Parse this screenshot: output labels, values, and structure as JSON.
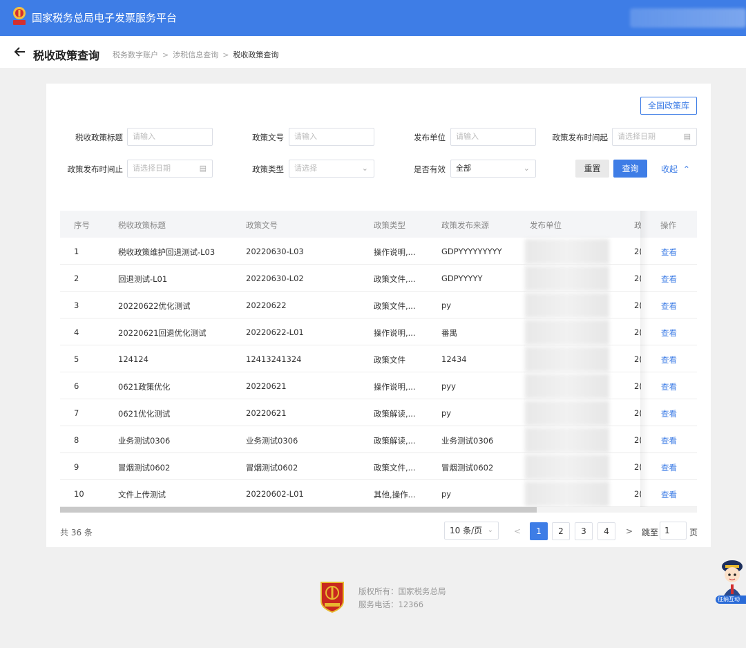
{
  "header": {
    "title": "国家税务总局电子发票服务平台"
  },
  "subheader": {
    "title": "税收政策查询",
    "breadcrumb": [
      "税务数字账户",
      "涉税信息查询",
      "税收政策查询"
    ],
    "sep": ">"
  },
  "toolbar": {
    "library_button": "全国政策库"
  },
  "filters": {
    "title_label": "税收政策标题",
    "title_placeholder": "请输入",
    "docno_label": "政策文号",
    "docno_placeholder": "请输入",
    "publisher_label": "发布单位",
    "publisher_placeholder": "请输入",
    "start_label": "政策发布时间起",
    "start_placeholder": "请选择日期",
    "end_label": "政策发布时间止",
    "end_placeholder": "请选择日期",
    "type_label": "政策类型",
    "type_placeholder": "请选择",
    "valid_label": "是否有效",
    "valid_value": "全部",
    "reset": "重置",
    "query": "查询",
    "collapse": "收起"
  },
  "table": {
    "headers": [
      "序号",
      "税收政策标题",
      "政策文号",
      "政策类型",
      "政策发布来源",
      "发布单位",
      "政",
      "操作"
    ],
    "rows": [
      {
        "no": "1",
        "title": "税收政策维护回退测试-L03",
        "docno": "20220630-L03",
        "type": "操作说明,...",
        "source": "GDPYYYYYYYYY",
        "date": "2(",
        "action": "查看"
      },
      {
        "no": "2",
        "title": "回退测试-L01",
        "docno": "20220630-L02",
        "type": "政策文件,...",
        "source": "GDPYYYYY",
        "date": "2(",
        "action": "查看"
      },
      {
        "no": "3",
        "title": "20220622优化测试",
        "docno": "20220622",
        "type": "政策文件,...",
        "source": "py",
        "date": "2(",
        "action": "查看"
      },
      {
        "no": "4",
        "title": "20220621回退优化测试",
        "docno": "20220622-L01",
        "type": "操作说明,...",
        "source": "番禺",
        "date": "2(",
        "action": "查看"
      },
      {
        "no": "5",
        "title": "124124",
        "docno": "12413241324",
        "type": "政策文件",
        "source": "12434",
        "date": "2(",
        "action": "查看"
      },
      {
        "no": "6",
        "title": "0621政策优化",
        "docno": "20220621",
        "type": "操作说明,...",
        "source": "pyy",
        "date": "2(",
        "action": "查看"
      },
      {
        "no": "7",
        "title": "0621优化测试",
        "docno": "20220621",
        "type": "政策解读,...",
        "source": "py",
        "date": "2(",
        "action": "查看"
      },
      {
        "no": "8",
        "title": "业务测试0306",
        "docno": "业务测试0306",
        "type": "政策解读,...",
        "source": "业务测试0306",
        "date": "2(",
        "action": "查看"
      },
      {
        "no": "9",
        "title": "冒烟测试0602",
        "docno": "冒烟测试0602",
        "type": "政策文件,...",
        "source": "冒烟测试0602",
        "date": "2(",
        "action": "查看"
      },
      {
        "no": "10",
        "title": "文件上传测试",
        "docno": "20220602-L01",
        "type": "其他,操作...",
        "source": "py",
        "date": "2(",
        "action": "查看"
      }
    ]
  },
  "pagination": {
    "total": "共 36 条",
    "page_size": "10 条/页",
    "pages": [
      "1",
      "2",
      "3",
      "4"
    ],
    "current": "1",
    "jump_prefix": "跳至",
    "jump_value": "1",
    "jump_suffix": "页"
  },
  "footer": {
    "copyright": "版权所有：国家税务总局",
    "phone": "服务电话：12366"
  },
  "widget": {
    "label": "征纳互动"
  },
  "colors": {
    "primary": "#3e7de6",
    "emblem_red": "#c8281e",
    "emblem_gold": "#e8b92f"
  }
}
